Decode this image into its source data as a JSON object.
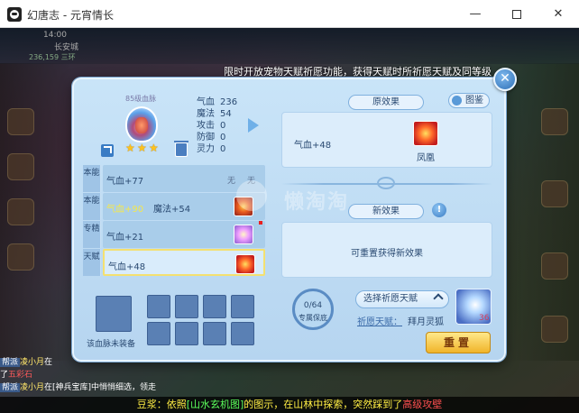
{
  "window": {
    "title": "幻唐志 - 元宵情长",
    "minimize_glyph": "—",
    "close_glyph": "✕"
  },
  "hud": {
    "time": "14:00",
    "map": "长安城",
    "coords": "236,159 三环"
  },
  "banner": "限时开放宠物天赋祈愿功能，获得天赋时所祈愿天赋及同等级",
  "pet": {
    "level_label": "85级血脉",
    "stars": [
      "★",
      "★",
      "★"
    ],
    "stats": [
      {
        "k": "气血",
        "v": "236"
      },
      {
        "k": "魔法",
        "v": "54"
      },
      {
        "k": "攻击",
        "v": "0"
      },
      {
        "k": "防御",
        "v": "0"
      },
      {
        "k": "灵力",
        "v": "0"
      }
    ]
  },
  "talents": [
    {
      "category": "本能",
      "a": "气血+77",
      "b": "",
      "none1": "无",
      "none2": "无",
      "icon": "none"
    },
    {
      "category": "本能",
      "a": "气血+90",
      "b": "魔法+54",
      "icon": "fire-icon"
    },
    {
      "category": "专精",
      "a": "气血+21",
      "b": "",
      "icon": "wing-icon"
    },
    {
      "category": "天赋",
      "a": "气血+48",
      "b": "",
      "icon": "phoenix-icon"
    }
  ],
  "original": {
    "title": "原效果",
    "effect": "气血+48",
    "icon_name": "凤凰",
    "gallery_label": "图鉴"
  },
  "new_effect": {
    "title": "新效果",
    "info_glyph": "!",
    "text": "可重置获得新效果"
  },
  "bottom": {
    "slot_label": "该血脉未装备",
    "protection_value": "0/64",
    "protection_label": "专属保底",
    "select_label": "选择祈愿天赋",
    "wish_label": "祈愿天赋：",
    "wish_value": "拜月灵狐",
    "wish_count": "36",
    "reset_label": "重置"
  },
  "watermark": "懒淘淘",
  "chat": [
    {
      "ch": "帮派",
      "nm": "凌小月",
      "tx": "在",
      "red": ""
    },
    {
      "ch": "",
      "nm": "",
      "tx": "了",
      "red": "五彩石"
    },
    {
      "ch": "帮派",
      "nm": "凌小月",
      "tx": "在[神兵宝库]中悄悄细选，领走",
      "red": ""
    }
  ],
  "marquee": {
    "prefix": "豆浆：",
    "part1": "依照",
    "map": "[山水玄机图]",
    "part2": "的图示，在山林中探索，突然踩到了",
    "trap": "高级攻壁"
  },
  "colors": {
    "dialog_bg": "#c9e4f8",
    "accent": "#2a6fb6",
    "highlight": "#f6e84a",
    "reset_btn": "#f0b42a"
  }
}
